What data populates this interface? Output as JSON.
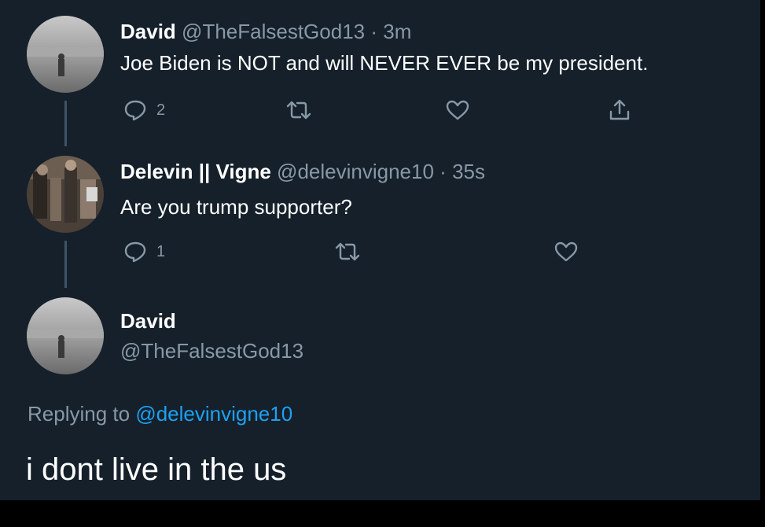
{
  "tweet1": {
    "name": "David",
    "handle": "@TheFalsestGod13",
    "separator": "·",
    "time": "3m",
    "text": "Joe Biden is NOT and will NEVER EVER be my president.",
    "reply_count": "2"
  },
  "tweet2": {
    "name": "Delevin || Vigne",
    "handle": "@delevinvigne10",
    "separator": "·",
    "time": "35s",
    "text": "Are you trump supporter?",
    "reply_count": "1"
  },
  "focus_tweet": {
    "name": "David",
    "handle": "@TheFalsestGod13",
    "replying_prefix": "Replying to",
    "replying_handle": "@delevinvigne10",
    "text": "i dont live in the us"
  },
  "icons": [
    "reply-icon",
    "retweet-icon",
    "like-icon",
    "share-icon"
  ],
  "colors": {
    "background": "#15202b",
    "text": "#ffffff",
    "muted": "#8899a6",
    "link": "#1da1f2",
    "thread_line": "#3d5466"
  }
}
